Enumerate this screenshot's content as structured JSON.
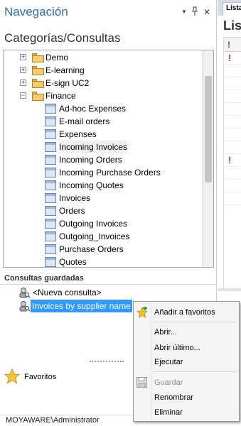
{
  "nav": {
    "title": "Navegación",
    "dropdown_glyph": "▼",
    "pin_glyph": "ᵖ",
    "close_glyph": "✕",
    "section_title": "Categorías/Consultas"
  },
  "tree": {
    "folders": [
      {
        "label": "Demo",
        "expander": "+"
      },
      {
        "label": "E-learning",
        "expander": "+"
      },
      {
        "label": "E-sign UC2",
        "expander": "+"
      },
      {
        "label": "Finance",
        "expander": "−"
      }
    ],
    "views": [
      "Ad-hoc Expenses",
      "E-mail orders",
      "Expenses",
      "Incoming Invoices",
      "Incoming Orders",
      "Incoming Purchase Orders",
      "Incoming Quotes",
      "Invoices",
      "Orders",
      "Outgoing Invoices",
      "Outgoing_Invoices",
      "Purchase Orders",
      "Quotes"
    ]
  },
  "saved": {
    "title": "Consultas guardadas",
    "new_query": "<Nueva consulta>",
    "selected_query": "Invoices by supplier name"
  },
  "favorites": {
    "label": "Favoritos"
  },
  "status": {
    "user": "MOYAWARE\\Administrator"
  },
  "right_pane": {
    "tab": "Lista",
    "title": "Lis",
    "header_mark": "!",
    "row_marks": [
      "!",
      "",
      "",
      "",
      "",
      "",
      "",
      "",
      "!",
      "",
      "",
      ""
    ]
  },
  "context_menu": {
    "add_favorites": "Añadir a favoritos",
    "open": "Abrir...",
    "open_last": "Abrir último...",
    "execute": "Ejecutar",
    "save": "Guardar",
    "rename": "Renombrar",
    "delete": "Eliminar"
  },
  "colors": {
    "title_blue": "#2e6cb8",
    "selection_blue": "#3399ff",
    "folder_yellow": "#f5cd6a",
    "alert_red": "#e02020"
  }
}
